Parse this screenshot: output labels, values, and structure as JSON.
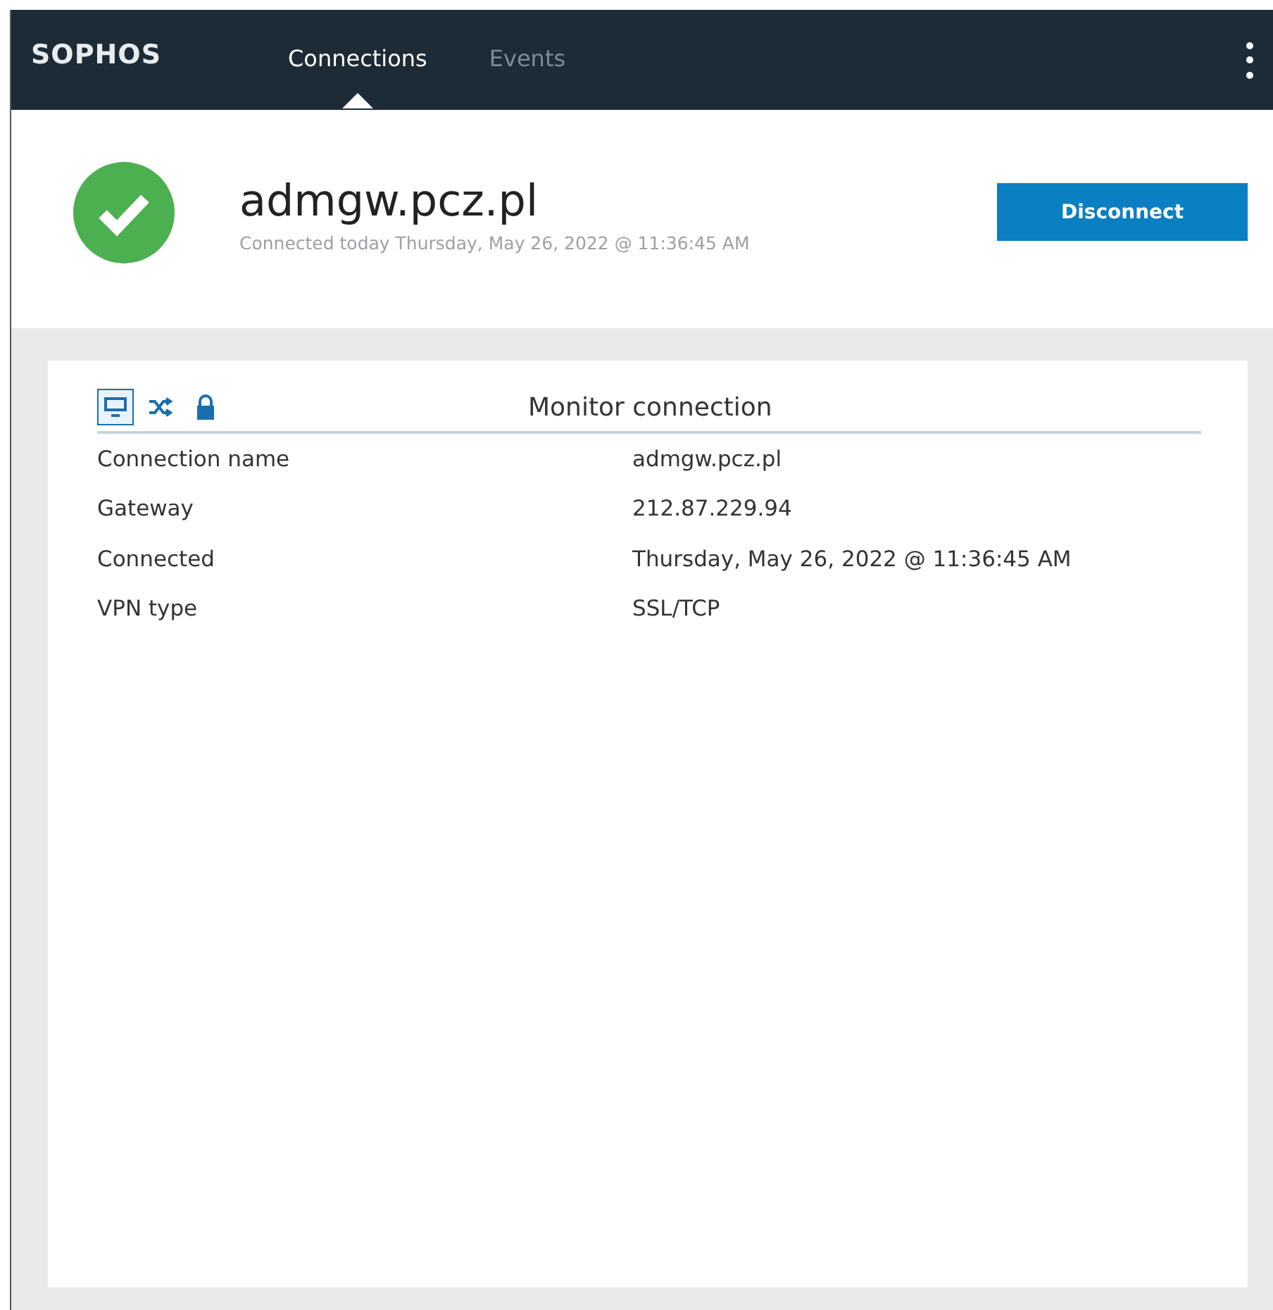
{
  "header": {
    "logo": "SOPHOS",
    "tabs": [
      {
        "label": "Connections",
        "selected": true
      },
      {
        "label": "Events",
        "selected": false
      }
    ]
  },
  "connection": {
    "connected": true,
    "name": "admgw.pcz.pl",
    "subtitle": "Connected today Thursday, May 26, 2022 @ 11:36:45 AM",
    "button": "Disconnect"
  },
  "panel": {
    "views": [
      {
        "kind": "monitor",
        "selected": true
      },
      {
        "kind": "shuffle",
        "selected": false
      },
      {
        "kind": "lock",
        "selected": false
      }
    ],
    "title": "Monitor connection",
    "rows": [
      {
        "label": "Connection name",
        "value": "admgw.pcz.pl"
      },
      {
        "label": "Gateway",
        "value": "212.87.229.94"
      },
      {
        "label": "Connected",
        "value": "Thursday, May 26, 2022 @ 11:36:45 AM"
      },
      {
        "label": "VPN type",
        "value": "SSL/TCP"
      }
    ]
  }
}
